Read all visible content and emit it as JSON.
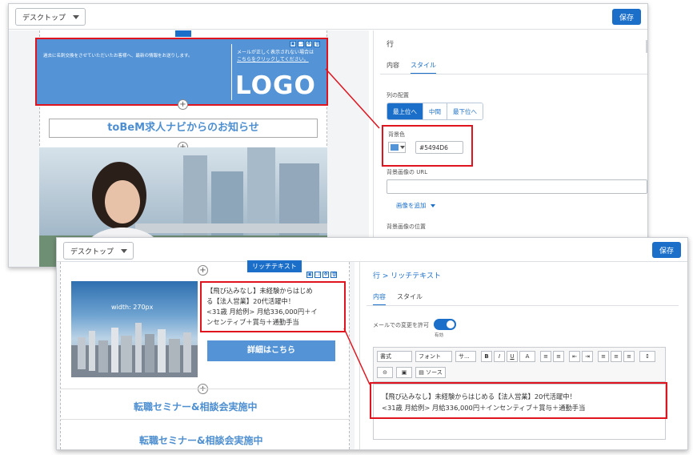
{
  "back_window": {
    "device_select": "デスクトップ",
    "save_label": "保存",
    "header_left_text": "過去に名刺交換をさせていただいたお客様へ、最新の情報をお送りします。",
    "header_right_text_line1": "メールが正しく表示されない場合は",
    "header_right_text_line2": "こちらをクリックしてください。",
    "logo_text": "LOGO",
    "title": "toBeM求人ナビからのお知らせ",
    "panel": {
      "title": "行",
      "tabs": [
        "内容",
        "スタイル"
      ],
      "active_tab": "スタイル",
      "column_align_label": "列の配置",
      "align_options": [
        "最上位へ",
        "中間",
        "最下位へ"
      ],
      "selected_align": "最上位へ",
      "bg_color_label": "背景色",
      "bg_color_value": "#5494D6",
      "bg_image_url_label": "背景画像の URL",
      "add_image_label": "画像を追加",
      "bg_image_position_label": "背景画像の位置"
    }
  },
  "front_window": {
    "device_select": "デスクトップ",
    "save_label": "保存",
    "rich_text_label": "リッチテキスト",
    "image_caption": "width: 270px",
    "rich_text_line1": "【飛び込みなし】未経験からはじめ",
    "rich_text_line2": "る【法人営業】20代活躍中！",
    "rich_text_line3": "<31歳 月給例> 月給336,000円＋イ",
    "rich_text_line4": "ンセンティブ＋賞与＋通勤手当",
    "detail_button": "詳細はこちら",
    "seminar_1": "転職セミナー&相談会実施中",
    "seminar_2": "転職セミナー&相談会実施中",
    "panel": {
      "breadcrumb": "行 > リッチテキスト",
      "tabs": [
        "内容",
        "スタイル"
      ],
      "active_tab": "内容",
      "email_edit_label": "メールでの変更を許可",
      "toggle_state": "有効",
      "toolbar": {
        "format": "書式",
        "font": "フォント",
        "size": "サ...",
        "bold": "B",
        "italic": "I",
        "underline": "U",
        "color": "A",
        "source": "ソース"
      },
      "editor_line1": "【飛び込みなし】未経験からはじめる【法人営業】20代活躍中！",
      "editor_line2": "<31歳 月給例> 月給336,000円＋インセンティブ＋賞与＋通勤手当"
    }
  },
  "colors": {
    "accent": "#1b6fc9",
    "header_blue": "#5494d6",
    "highlight_red": "#e0141e"
  }
}
